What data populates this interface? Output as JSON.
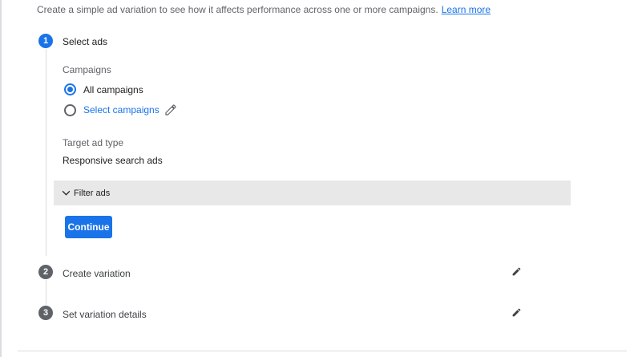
{
  "intro": {
    "text": "Create a simple ad variation to see how it affects performance across one or more campaigns.",
    "learn_more": "Learn more"
  },
  "steps": [
    {
      "number": "1",
      "title": "Select ads",
      "state": "active"
    },
    {
      "number": "2",
      "title": "Create variation",
      "state": "inactive"
    },
    {
      "number": "3",
      "title": "Set variation details",
      "state": "inactive"
    }
  ],
  "campaigns": {
    "label": "Campaigns",
    "options": [
      {
        "label": "All campaigns",
        "checked": true
      },
      {
        "label": "Select campaigns",
        "checked": false
      }
    ]
  },
  "target_ad_type": {
    "label": "Target ad type",
    "value": "Responsive search ads"
  },
  "filter": {
    "label": "Filter ads"
  },
  "continue_label": "Continue",
  "colors": {
    "accent": "#1a73e8",
    "inactive_step": "#5f6368",
    "filter_bar": "#e8e8e8"
  },
  "icons": {
    "edit": "pencil-icon",
    "expand": "chevron-down-icon"
  }
}
